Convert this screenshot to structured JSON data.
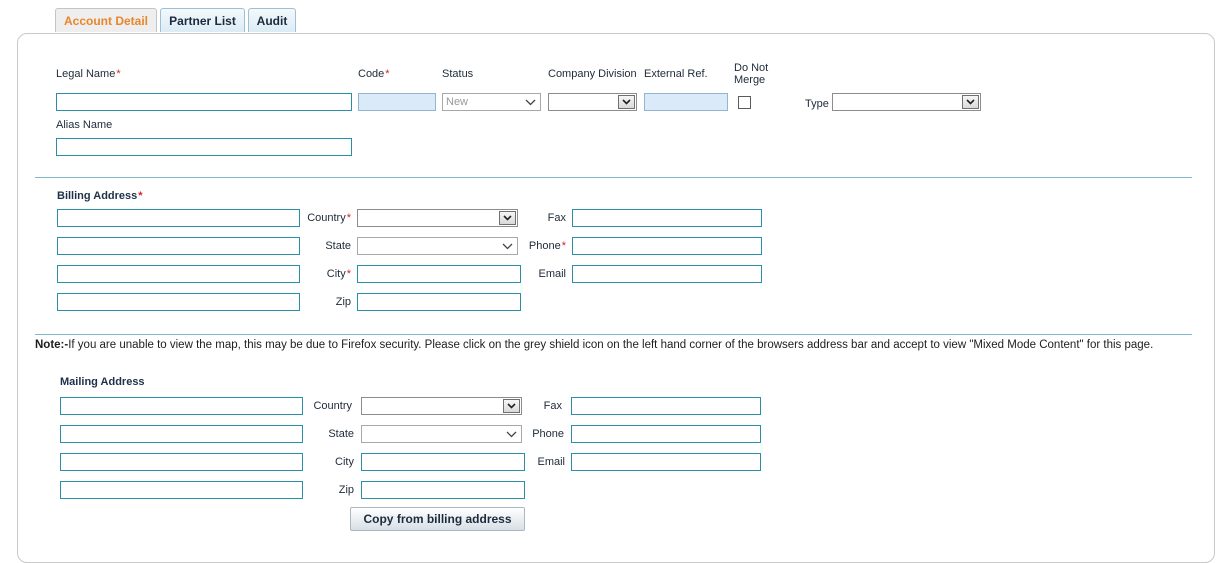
{
  "tabs": [
    {
      "label": "Account Detail"
    },
    {
      "label": "Partner List"
    },
    {
      "label": "Audit"
    }
  ],
  "account": {
    "legal_name_label": "Legal Name",
    "code_label": "Code",
    "status_label": "Status",
    "status_value": "New",
    "company_division_label": "Company Division",
    "external_ref_label": "External Ref.",
    "do_not_merge_label_line1": "Do Not",
    "do_not_merge_label_line2": "Merge",
    "type_label": "Type",
    "alias_name_label": "Alias Name",
    "required_mark": "*"
  },
  "billing": {
    "title": "Billing Address",
    "country_label": "Country",
    "state_label": "State",
    "city_label": "City",
    "zip_label": "Zip",
    "fax_label": "Fax",
    "phone_label": "Phone",
    "email_label": "Email"
  },
  "note": {
    "prefix": "Note:-",
    "text": "If you are unable to view the map, this may be due to Firefox security. Please click on the grey shield icon on the left hand corner of the browsers address bar and accept to view \"Mixed Mode Content\" for this page."
  },
  "mailing": {
    "title": "Mailing Address",
    "country_label": "Country",
    "state_label": "State",
    "city_label": "City",
    "zip_label": "Zip",
    "fax_label": "Fax",
    "phone_label": "Phone",
    "email_label": "Email",
    "copy_button": "Copy from billing address"
  }
}
